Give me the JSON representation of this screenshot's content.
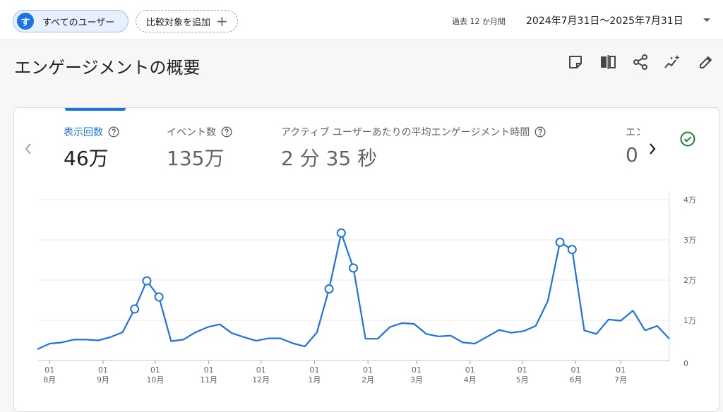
{
  "topbar": {
    "segment": {
      "avatar": "す",
      "label": "すべてのユーザー",
      "avatar_color": "#1a73e8"
    },
    "compare": {
      "label": "比較対象を追加",
      "icon": "plus-icon"
    },
    "period_label": "過去 12 か月間",
    "date_range": "2024年7月31日～2025年7月31日"
  },
  "page": {
    "title": "エンゲージメントの概要",
    "toolbar_icons": [
      "note-icon",
      "compare-columns-icon",
      "share-icon",
      "insights-sparkle-icon",
      "edit-pencil-icon"
    ]
  },
  "metrics": [
    {
      "label": "表示回数",
      "value": "46万",
      "active": true
    },
    {
      "label": "イベント数",
      "value": "135万",
      "active": false
    },
    {
      "label": "アクティブ ユーザーあたりの平均エンゲージメント時間",
      "value": "2 分 35 秒",
      "active": false
    },
    {
      "label": "エン",
      "value": "0",
      "active": false
    }
  ],
  "colors": {
    "accent": "#1a73e8",
    "series": "#1a73e8",
    "status_ok": "#188038"
  },
  "chart_data": {
    "type": "line",
    "y_axis": {
      "ticks": [
        "0",
        "1万",
        "2万",
        "3万",
        "4万"
      ],
      "min": 0,
      "max": 40000,
      "position": "right"
    },
    "x_axis": {
      "ticks": [
        {
          "day": "01",
          "month": "8月",
          "week": 1
        },
        {
          "day": "01",
          "month": "9月",
          "week": 5.4
        },
        {
          "day": "01",
          "month": "10月",
          "week": 9.7
        },
        {
          "day": "01",
          "month": "11月",
          "week": 14.1
        },
        {
          "day": "01",
          "month": "12月",
          "week": 18.4
        },
        {
          "day": "01",
          "month": "1月",
          "week": 22.8
        },
        {
          "day": "01",
          "month": "2月",
          "week": 27.2
        },
        {
          "day": "01",
          "month": "3月",
          "week": 31.2
        },
        {
          "day": "01",
          "month": "4月",
          "week": 35.6
        },
        {
          "day": "01",
          "month": "5月",
          "week": 39.9
        },
        {
          "day": "01",
          "month": "6月",
          "week": 44.3
        },
        {
          "day": "01",
          "month": "7月",
          "week": 48.0
        }
      ]
    },
    "series": [
      {
        "values": [
          2800,
          4200,
          4500,
          5200,
          5200,
          5000,
          5800,
          7000,
          12800,
          19800,
          15800,
          4800,
          5200,
          7000,
          8300,
          9000,
          6800,
          5800,
          4900,
          5500,
          5500,
          4300,
          3500,
          7000,
          17800,
          31700,
          23000,
          5400,
          5400,
          8300,
          9300,
          9100,
          6600,
          6000,
          6200,
          4500,
          4200,
          5900,
          7600,
          6900,
          7300,
          8600,
          14800,
          29400,
          27600,
          7500,
          6600,
          10200,
          9900,
          12400,
          7500,
          8600,
          5400
        ],
        "marker_indices": [
          8,
          9,
          10,
          24,
          25,
          26,
          43,
          44
        ]
      }
    ],
    "grid": true,
    "legend": "none"
  }
}
